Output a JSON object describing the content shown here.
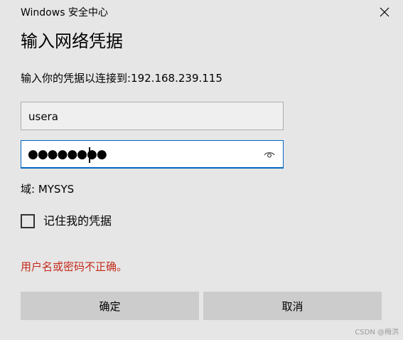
{
  "window": {
    "title": "Windows 安全中心",
    "close_icon": "close-icon"
  },
  "dialog": {
    "heading": "输入网络凭据",
    "prompt": "输入你的凭据以连接到:192.168.239.115",
    "username": {
      "value": "usera"
    },
    "password": {
      "masked_value": "●●●●●●●●",
      "reveal_icon": "eye-icon"
    },
    "domain_label": "域: MYSYS",
    "remember": {
      "label": "记住我的凭据",
      "checked": false
    },
    "error": "用户名或密码不正确。",
    "buttons": {
      "ok": "确定",
      "cancel": "取消"
    }
  },
  "watermark": "CSDN @梅洪",
  "colors": {
    "background": "#e6e6e6",
    "error": "#c42b1c",
    "focus_border": "#0067c0",
    "button": "#cccccc"
  }
}
